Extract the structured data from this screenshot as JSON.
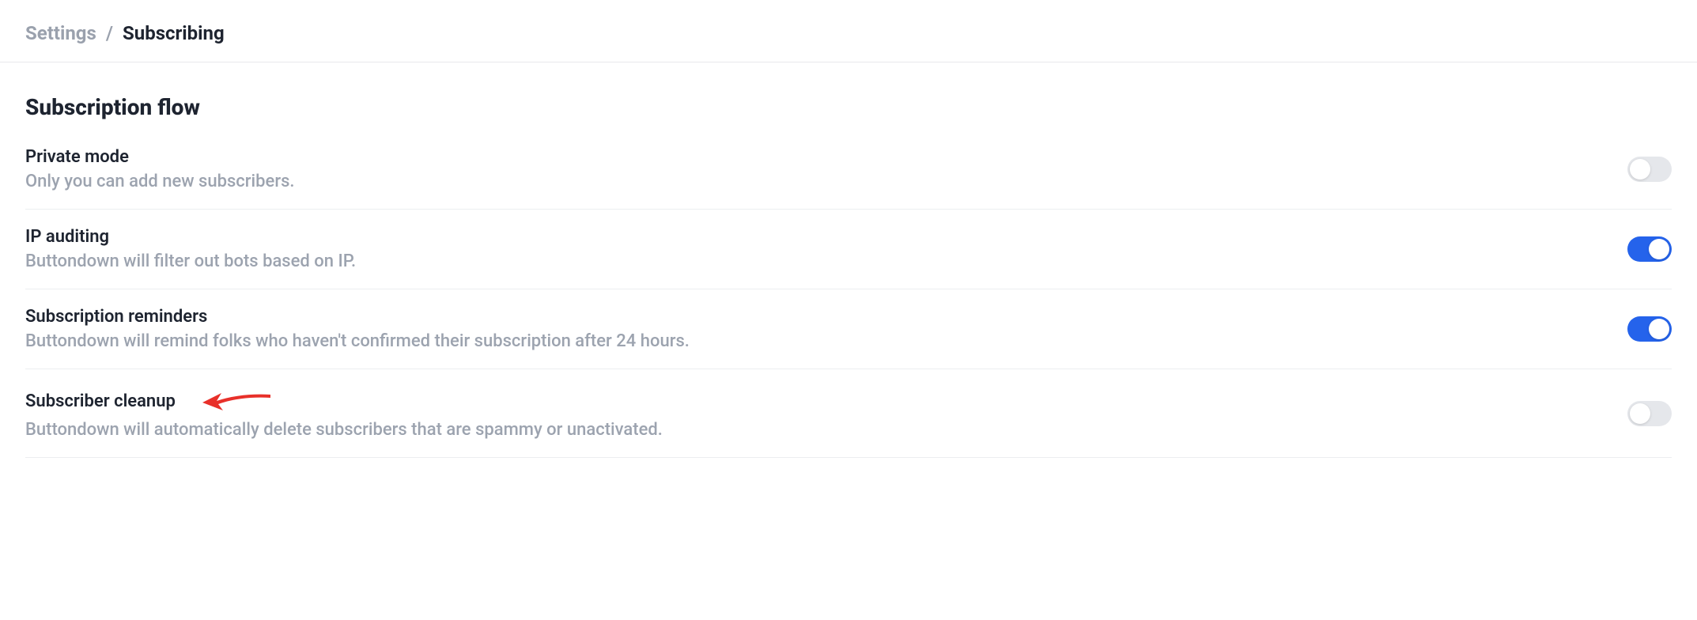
{
  "breadcrumb": {
    "parent": "Settings",
    "separator": "/",
    "current": "Subscribing"
  },
  "section": {
    "title": "Subscription flow"
  },
  "settings": [
    {
      "key": "private-mode",
      "title": "Private mode",
      "description": "Only you can add new subscribers.",
      "enabled": false,
      "annotated": false
    },
    {
      "key": "ip-auditing",
      "title": "IP auditing",
      "description": "Buttondown will filter out bots based on IP.",
      "enabled": true,
      "annotated": false
    },
    {
      "key": "subscription-reminders",
      "title": "Subscription reminders",
      "description": "Buttondown will remind folks who haven't confirmed their subscription after 24 hours.",
      "enabled": true,
      "annotated": false
    },
    {
      "key": "subscriber-cleanup",
      "title": "Subscriber cleanup",
      "description": "Buttondown will automatically delete subscribers that are spammy or unactivated.",
      "enabled": false,
      "annotated": true
    }
  ],
  "colors": {
    "toggle_on": "#2563eb",
    "toggle_off": "#e5e7eb",
    "annotation_arrow": "#e8302a"
  }
}
